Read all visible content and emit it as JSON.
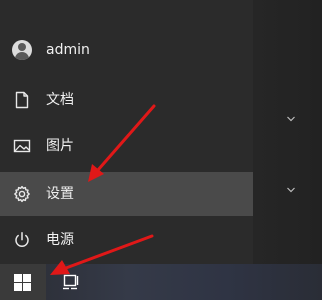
{
  "start_menu": {
    "items": [
      {
        "label": "admin",
        "icon": "user-avatar-icon"
      },
      {
        "label": "文档",
        "icon": "document-icon"
      },
      {
        "label": "图片",
        "icon": "picture-icon"
      },
      {
        "label": "设置",
        "icon": "gear-icon",
        "selected": true
      },
      {
        "label": "电源",
        "icon": "power-icon"
      }
    ]
  },
  "tiles": {
    "group_chevrons": [
      "chevron-down-icon",
      "chevron-down-icon"
    ]
  },
  "taskbar": {
    "start_icon": "windows-logo-icon",
    "task_view_icon": "task-view-icon"
  },
  "annotations": {
    "arrow_color": "#e01818"
  },
  "colors": {
    "rail_bg": "#2b2b2b",
    "selected_bg": "#4a4a4a",
    "text": "#f0f0f0"
  }
}
